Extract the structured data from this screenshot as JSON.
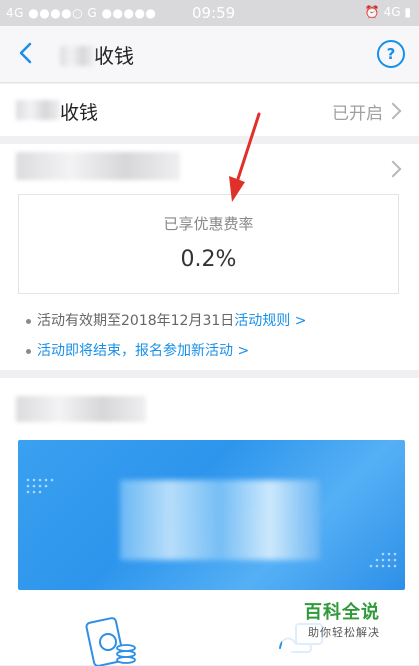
{
  "statusbar": {
    "carrier": "4G ●●●●○ G ●●●●●",
    "time": "09:59",
    "right": "⏰ 4G ▮"
  },
  "nav": {
    "title": "收钱",
    "help": "?"
  },
  "row1": {
    "label": "收钱",
    "status": "已开启"
  },
  "rate": {
    "label": "已享优惠费率",
    "value": "0.2%"
  },
  "notes": [
    {
      "text": "活动有效期至2018年12月31日",
      "link": "活动规则 >"
    },
    {
      "link": "活动即将结束，报名参加新活动 >"
    }
  ],
  "watermark": {
    "title": "百科全说",
    "subtitle": "助你轻松解决"
  },
  "colors": {
    "accent": "#1890e8",
    "banner": "#2d95ec"
  }
}
